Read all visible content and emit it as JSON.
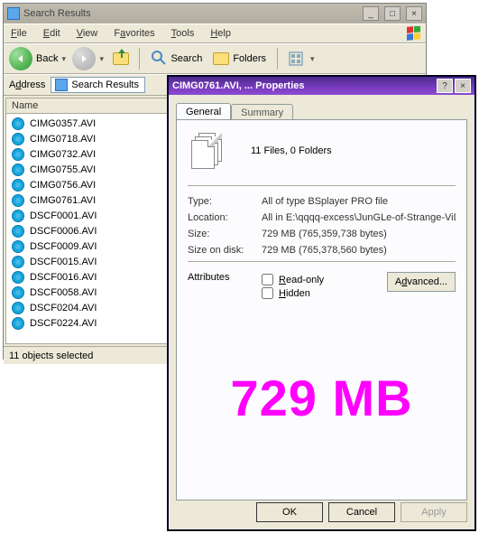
{
  "explorer": {
    "title": "Search Results",
    "menu": {
      "file": "File",
      "edit": "Edit",
      "view": "View",
      "favorites": "Favorites",
      "tools": "Tools",
      "help": "Help"
    },
    "tool": {
      "back": "Back",
      "search": "Search",
      "folders": "Folders"
    },
    "address_label": "Address",
    "address_value": "Search Results",
    "list_header": "Name",
    "files": [
      "CIMG0357.AVI",
      "CIMG0718.AVI",
      "CIMG0732.AVI",
      "CIMG0755.AVI",
      "CIMG0756.AVI",
      "CIMG0761.AVI",
      "DSCF0001.AVI",
      "DSCF0006.AVI",
      "DSCF0009.AVI",
      "DSCF0015.AVI",
      "DSCF0016.AVI",
      "DSCF0058.AVI",
      "DSCF0204.AVI",
      "DSCF0224.AVI"
    ],
    "status": "11 objects selected"
  },
  "props": {
    "title": "CIMG0761.AVI, ... Properties",
    "tabs": {
      "general": "General",
      "summary": "Summary"
    },
    "count": "11 Files, 0 Folders",
    "rows": {
      "type_k": "Type:",
      "type_v": "All of type BSplayer PRO file",
      "loc_k": "Location:",
      "loc_v": "All in E:\\qqqq-excess\\JunGLe-of-Strange-ViDeO-C",
      "size_k": "Size:",
      "size_v": "729 MB (765,359,738 bytes)",
      "sod_k": "Size on disk:",
      "sod_v": "729 MB (765,378,560 bytes)"
    },
    "attrs": {
      "label": "Attributes",
      "readonly": "Read-only",
      "hidden": "Hidden",
      "advanced": "Advanced..."
    },
    "big": "729 MB",
    "buttons": {
      "ok": "OK",
      "cancel": "Cancel",
      "apply": "Apply"
    }
  }
}
